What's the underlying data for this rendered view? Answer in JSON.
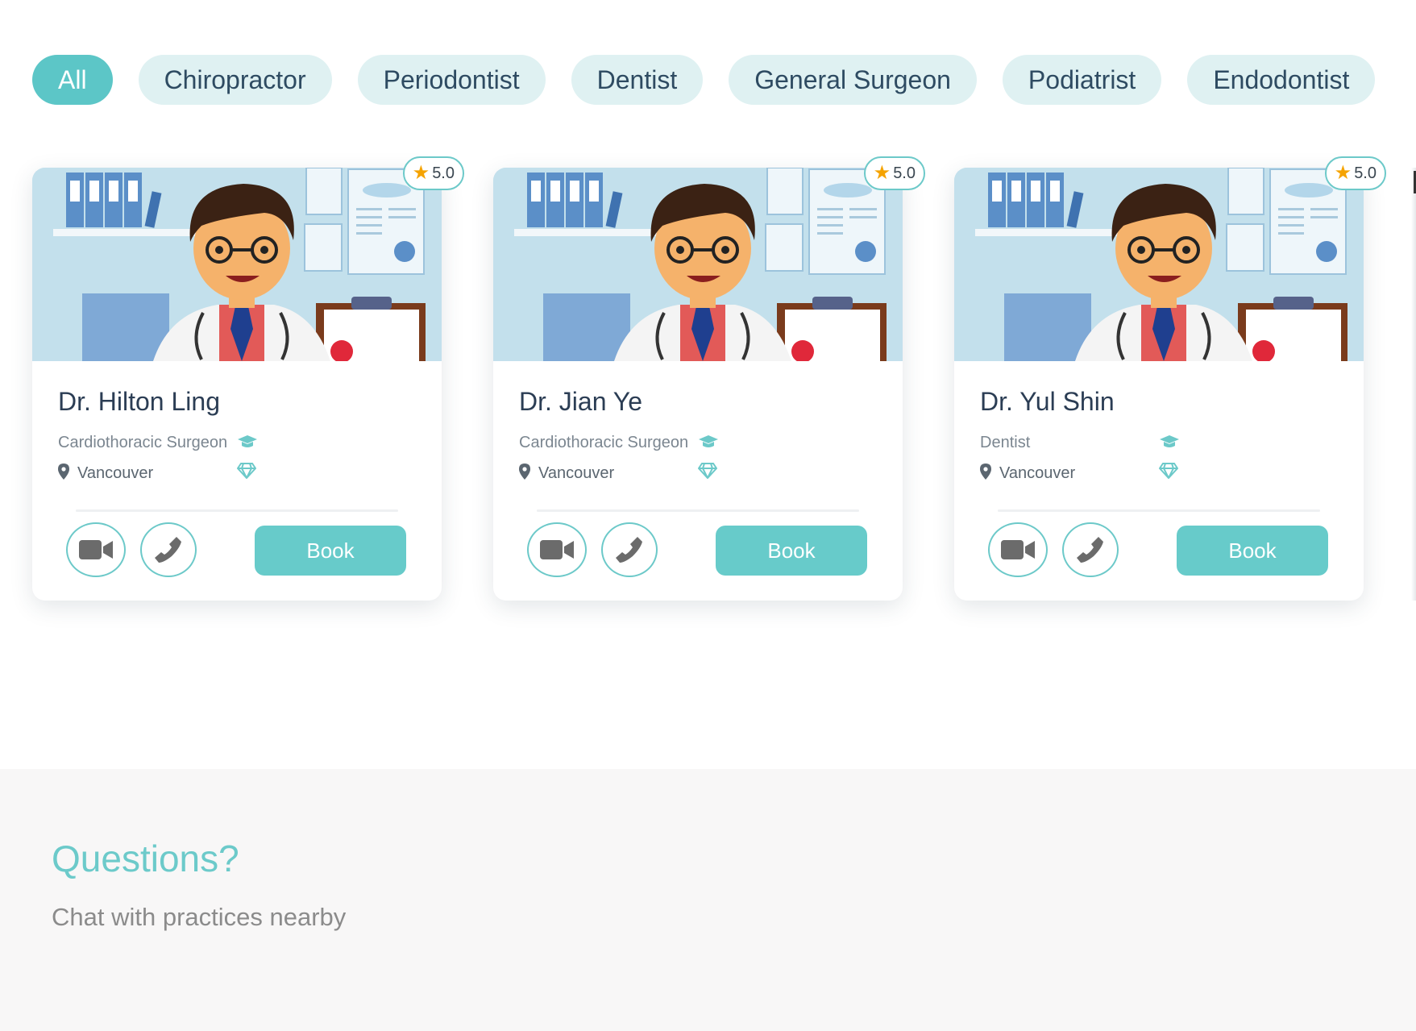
{
  "filters": [
    {
      "label": "All",
      "active": true
    },
    {
      "label": "Chiropractor",
      "active": false
    },
    {
      "label": "Periodontist",
      "active": false
    },
    {
      "label": "Dentist",
      "active": false
    },
    {
      "label": "General Surgeon",
      "active": false
    },
    {
      "label": "Podiatrist",
      "active": false
    },
    {
      "label": "Endodontist",
      "active": false
    }
  ],
  "doctors": [
    {
      "name": "Dr. Hilton Ling",
      "specialty": "Cardiothoracic Surgeon",
      "city": "Vancouver",
      "rating": "5.0",
      "book_label": "Book"
    },
    {
      "name": "Dr. Jian Ye",
      "specialty": "Cardiothoracic Surgeon",
      "city": "Vancouver",
      "rating": "5.0",
      "book_label": "Book"
    },
    {
      "name": "Dr. Yul Shin",
      "specialty": "Dentist",
      "city": "Vancouver",
      "rating": "5.0",
      "book_label": "Book"
    }
  ],
  "icons": {
    "star": "star-icon",
    "specialty": "graduation-cap-icon",
    "location": "map-pin-icon",
    "tier": "diamond-icon",
    "video": "video-camera-icon",
    "phone": "phone-icon"
  },
  "colors": {
    "accent": "#5cc6c7",
    "pill_bg": "#dff1f2",
    "star": "#f5a300",
    "text_dark": "#2b3d54"
  },
  "questions": {
    "title": "Questions?",
    "subtitle": "Chat with practices nearby"
  }
}
